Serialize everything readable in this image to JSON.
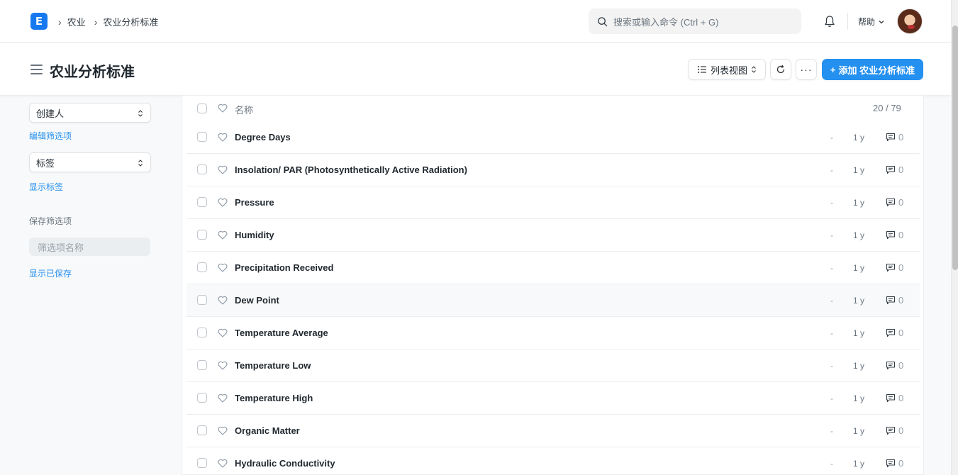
{
  "navbar": {
    "logo_letter": "E",
    "breadcrumbs": [
      "农业",
      "农业分析标准"
    ],
    "search_placeholder": "搜索或输入命令 (Ctrl + G)",
    "help_label": "帮助"
  },
  "page": {
    "title": "农业分析标准",
    "list_view_label": "列表视图",
    "more_label": "···",
    "add_button_label": "添加 农业分析标准"
  },
  "sidebar": {
    "created_by_label": "创建人",
    "edit_filters_link": "编辑筛选项",
    "tags_label": "标签",
    "show_tags_link": "显示标签",
    "saved_filters_heading": "保存筛选项",
    "filter_name_placeholder": "筛选项名称",
    "show_saved_link": "显示已保存"
  },
  "list": {
    "header_label": "名称",
    "count": "20 / 79",
    "rows": [
      {
        "title": "Degree Days",
        "status": "-",
        "modified": "1 y",
        "comments": "0"
      },
      {
        "title": "Insolation/ PAR (Photosynthetically Active Radiation)",
        "status": "-",
        "modified": "1 y",
        "comments": "0"
      },
      {
        "title": "Pressure",
        "status": "-",
        "modified": "1 y",
        "comments": "0"
      },
      {
        "title": "Humidity",
        "status": "-",
        "modified": "1 y",
        "comments": "0"
      },
      {
        "title": "Precipitation Received",
        "status": "-",
        "modified": "1 y",
        "comments": "0"
      },
      {
        "title": "Dew Point",
        "status": "-",
        "modified": "1 y",
        "comments": "0"
      },
      {
        "title": "Temperature Average",
        "status": "-",
        "modified": "1 y",
        "comments": "0"
      },
      {
        "title": "Temperature Low",
        "status": "-",
        "modified": "1 y",
        "comments": "0"
      },
      {
        "title": "Temperature High",
        "status": "-",
        "modified": "1 y",
        "comments": "0"
      },
      {
        "title": "Organic Matter",
        "status": "-",
        "modified": "1 y",
        "comments": "0"
      },
      {
        "title": "Hydraulic Conductivity",
        "status": "-",
        "modified": "1 y",
        "comments": "0"
      }
    ]
  },
  "colors": {
    "primary": "#2490ef",
    "logo": "#1779f0"
  }
}
